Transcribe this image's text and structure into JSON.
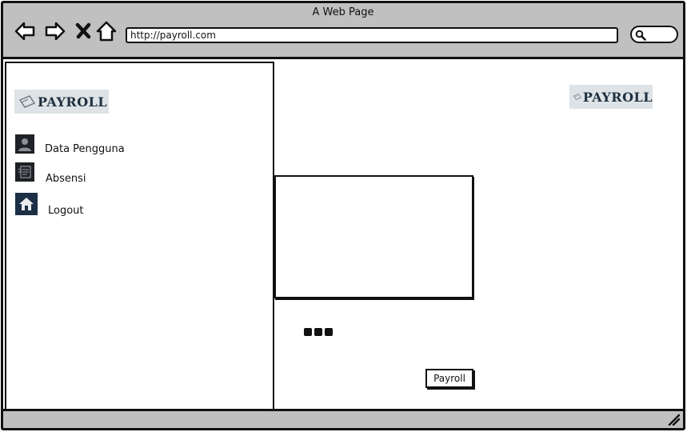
{
  "browser": {
    "title": "A Web Page",
    "url": "http://payroll.com",
    "icons": {
      "back": "arrow-left-icon",
      "forward": "arrow-right-icon",
      "close": "close-icon",
      "home": "home-icon",
      "search": "search-icon"
    }
  },
  "sidebar": {
    "logo_text": "PAYROLL",
    "items": [
      {
        "label": "Data Pengguna",
        "icon": "user-icon"
      },
      {
        "label": "Absensi",
        "icon": "document-list-icon"
      },
      {
        "label": "Logout",
        "icon": "home-icon"
      }
    ]
  },
  "main": {
    "logo_text": "PAYROLL",
    "payroll_button_label": "Payroll"
  }
}
